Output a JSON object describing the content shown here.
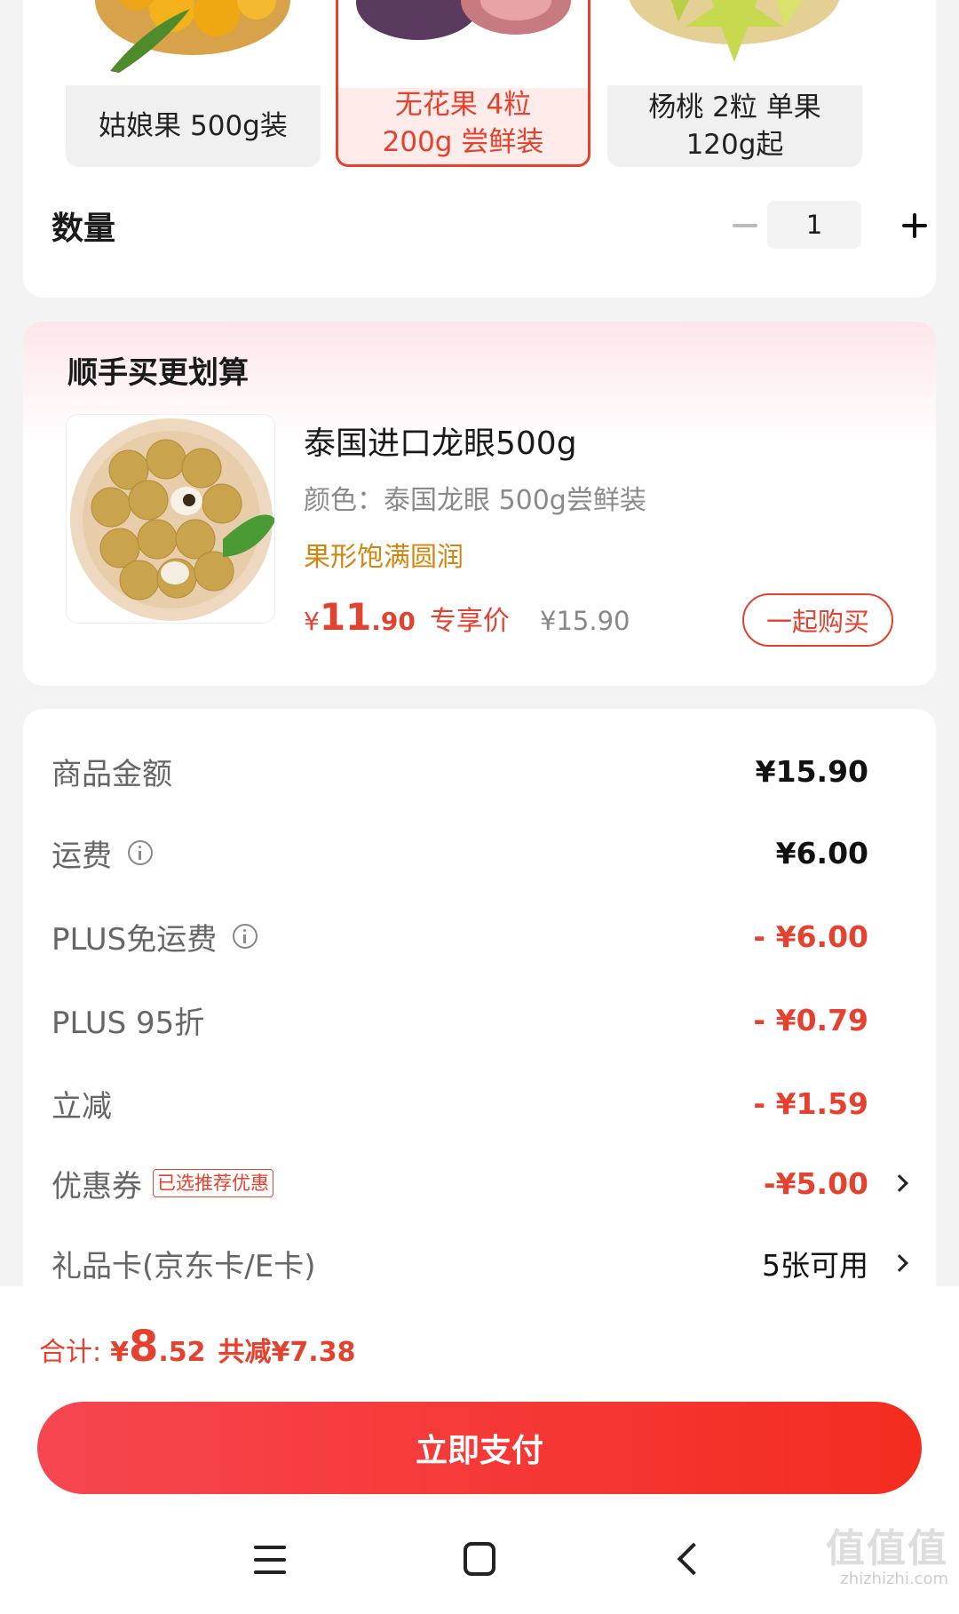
{
  "sku_options": [
    {
      "label": "姑娘果 500g装",
      "selected": false
    },
    {
      "label": "无花果 4粒\n200g 尝鲜装",
      "selected": true
    },
    {
      "label": "杨桃 2粒 单果\n120g起",
      "selected": false
    }
  ],
  "quantity": {
    "label": "数量",
    "value": "1"
  },
  "addon": {
    "section_title": "顺手买更划算",
    "name": "泰国进口龙眼500g",
    "spec": "颜色：泰国龙眼 500g尝鲜装",
    "tag": "果形饱满圆润",
    "price_symbol": "¥",
    "price_int": "11",
    "price_dec": ".90",
    "price_note": "专享价",
    "original_price": "¥15.90",
    "button": "一起购买"
  },
  "summary": {
    "goods_amount": {
      "label": "商品金额",
      "value": "¥15.90"
    },
    "shipping": {
      "label": "运费",
      "value": "¥6.00"
    },
    "plus_free_shipping": {
      "label": "PLUS免运费",
      "value": "- ¥6.00"
    },
    "plus_discount": {
      "label": "PLUS 95折",
      "value": "- ¥0.79"
    },
    "instant_discount": {
      "label": "立减",
      "value": "- ¥1.59"
    },
    "coupon": {
      "label": "优惠券",
      "badge": "已选推荐优惠",
      "value": "-¥5.00"
    },
    "gift_card": {
      "label": "礼品卡(京东卡/E卡)",
      "value": "5张可用"
    }
  },
  "total": {
    "label": "合计:",
    "symbol": "¥",
    "int": "8",
    "dec": ".52",
    "saved": "共减¥7.38"
  },
  "pay_button": "立即支付",
  "watermark": {
    "main": "值值值",
    "sub": "zhizhizhi.com"
  },
  "colors": {
    "accent": "#e4412f",
    "tag": "#d1860f",
    "pay_gradient_start": "#f64650",
    "pay_gradient_end": "#f42c1f"
  }
}
